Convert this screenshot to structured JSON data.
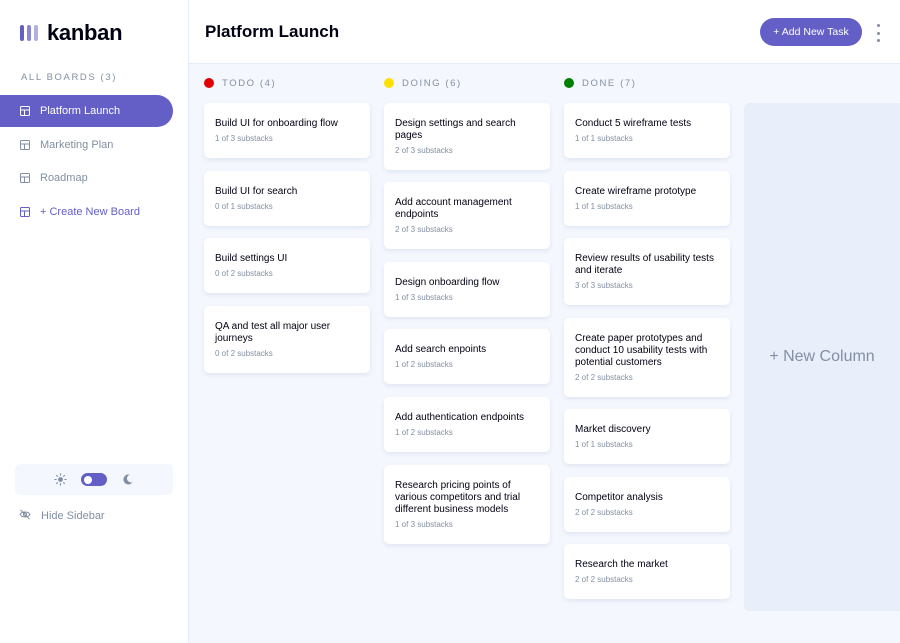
{
  "app": {
    "logo_text": "kanban"
  },
  "sidebar": {
    "boards_heading": "ALL BOARDS (3)",
    "boards": [
      {
        "label": "Platform Launch",
        "active": true
      },
      {
        "label": "Marketing Plan",
        "active": false
      },
      {
        "label": "Roadmap",
        "active": false
      }
    ],
    "create_board_label": "+ Create New Board",
    "hide_sidebar_label": "Hide Sidebar",
    "theme": {
      "light_icon": "sun-icon",
      "dark_icon": "moon-icon",
      "dark_mode_on": true
    }
  },
  "header": {
    "title": "Platform Launch",
    "add_task_label": "+ Add New Task",
    "menu_icon": "vertical-ellipsis-icon"
  },
  "columns": [
    {
      "label": "TODO (4)",
      "dot_color": "#e20000",
      "cards": [
        {
          "title": "Build UI for onboarding flow",
          "subtasks": "1 of 3 substacks"
        },
        {
          "title": "Build UI for search",
          "subtasks": "0 of 1 substacks"
        },
        {
          "title": "Build settings UI",
          "subtasks": "0 of 2 substacks"
        },
        {
          "title": "QA and test all major user journeys",
          "subtasks": "0 of 2 substacks"
        }
      ]
    },
    {
      "label": "DOING (6)",
      "dot_color": "#ffe000",
      "cards": [
        {
          "title": "Design settings and search pages",
          "subtasks": "2 of 3 substacks"
        },
        {
          "title": "Add account management endpoints",
          "subtasks": "2 of 3 substacks"
        },
        {
          "title": "Design onboarding flow",
          "subtasks": "1 of 3 substacks"
        },
        {
          "title": "Add search enpoints",
          "subtasks": "1 of 2 substacks"
        },
        {
          "title": "Add authentication endpoints",
          "subtasks": "1 of 2 substacks"
        },
        {
          "title": "Research pricing points of various competitors and trial different business models",
          "subtasks": "1 of 3 substacks"
        }
      ]
    },
    {
      "label": "DONE (7)",
      "dot_color": "#008000",
      "cards": [
        {
          "title": "Conduct 5 wireframe tests",
          "subtasks": "1 of 1 substacks"
        },
        {
          "title": "Create wireframe prototype",
          "subtasks": "1 of 1 substacks"
        },
        {
          "title": "Review results of usability tests and iterate",
          "subtasks": "3 of 3 substacks"
        },
        {
          "title": "Create paper prototypes and conduct 10 usability tests with potential customers",
          "subtasks": "2 of 2 substacks"
        },
        {
          "title": "Market discovery",
          "subtasks": "1 of 1 substacks"
        },
        {
          "title": "Competitor analysis",
          "subtasks": "2 of 2 substacks"
        },
        {
          "title": "Research the market",
          "subtasks": "2 of 2 substacks"
        }
      ]
    }
  ],
  "new_column_label": "+ New Column",
  "colors": {
    "accent": "#635fc7",
    "muted_text": "#828fa3",
    "board_bg": "#f4f7fd"
  }
}
